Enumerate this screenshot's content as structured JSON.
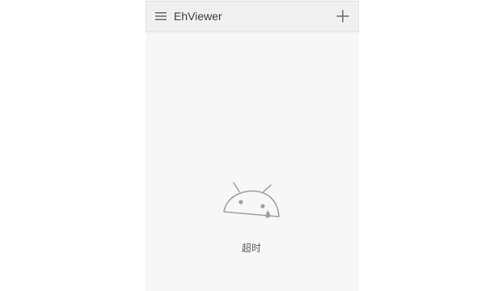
{
  "toolbar": {
    "menu_icon": "menu-icon",
    "title": "EhViewer",
    "add_icon": "plus-icon"
  },
  "content": {
    "illustration_icon": "sad-android-icon",
    "status_text": "超时"
  },
  "colors": {
    "page_background": "#f7f7f7",
    "toolbar_background": "#f0f0f0",
    "icon_grey": "#9e9e9e",
    "title_text": "#3c3c3c",
    "status_text": "#5a5a5a"
  }
}
